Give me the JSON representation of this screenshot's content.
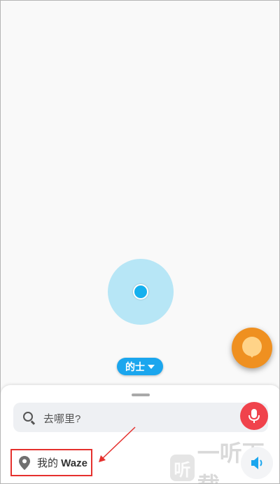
{
  "map": {
    "vehicle_label": "的士"
  },
  "search": {
    "placeholder": "去哪里?"
  },
  "my_waze": {
    "label_prefix": "我的 ",
    "label_brand": "Waze"
  },
  "watermark": {
    "logo_char": "听",
    "text": "一听下载"
  },
  "colors": {
    "accent_blue": "#1ba6ee",
    "location_dot": "#15b0ee",
    "accuracy_circle": "#b7e6f6",
    "mic_red": "#f0434c",
    "report_orange": "#ef9020",
    "annotation_red": "#e5312e"
  },
  "icons": {
    "search": "search-icon",
    "mic": "microphone-icon",
    "pin": "location-pin-icon",
    "sound": "sound-icon",
    "report": "report-bubble-icon",
    "caret": "caret-down-icon"
  }
}
